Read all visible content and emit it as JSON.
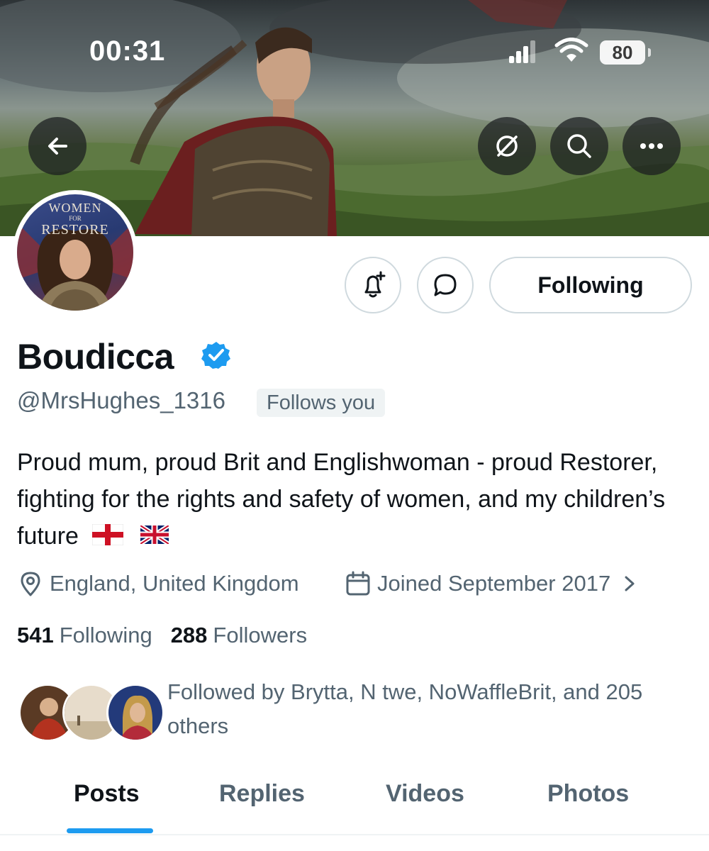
{
  "status_bar": {
    "time": "00:31",
    "battery": "80"
  },
  "profile": {
    "display_name": "Boudicca",
    "handle": "@MrsHughes_1316",
    "follows_you": "Follows you",
    "bio": "Proud mum, proud Brit and Englishwoman - proud Restorer, fighting for the rights and safety of women, and my children’s future",
    "location": "England, United Kingdom",
    "joined": "Joined September 2017",
    "following_count": "541",
    "following_label": "Following",
    "followers_count": "288",
    "followers_label": "Followers",
    "followed_by": "Followed by Brytta, N twe, NoWaffleBrit, and 205 others",
    "avatar_text_line1": "WOMEN",
    "avatar_text_line2": "FOR",
    "avatar_text_line3": "RESTORE"
  },
  "actions": {
    "following_button": "Following"
  },
  "tabs": [
    {
      "label": "Posts",
      "active": true
    },
    {
      "label": "Replies",
      "active": false
    },
    {
      "label": "Videos",
      "active": false
    },
    {
      "label": "Photos",
      "active": false
    }
  ],
  "colors": {
    "accent": "#1d9bf0",
    "text_primary": "#0f1419",
    "text_secondary": "#536471",
    "border": "#cfd9de"
  },
  "icons": [
    "back-arrow-icon",
    "translate-off-icon",
    "search-icon",
    "more-icon",
    "notification-bell-plus-icon",
    "message-icon",
    "verified-badge-icon",
    "location-pin-icon",
    "calendar-icon",
    "chevron-right-icon",
    "england-flag-icon",
    "union-jack-icon"
  ]
}
